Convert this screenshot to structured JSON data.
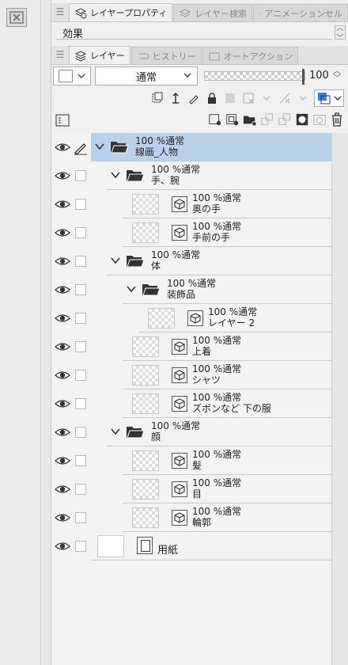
{
  "tabs_top": [
    {
      "label": "レイヤープロパティ",
      "active": true
    },
    {
      "label": "レイヤー検索",
      "active": false
    },
    {
      "label": "アニメーションセル",
      "active": false
    }
  ],
  "effect": {
    "label": "効果"
  },
  "tabs_layer": [
    {
      "label": "レイヤー",
      "active": true
    },
    {
      "label": "ヒストリー",
      "active": false
    },
    {
      "label": "オートアクション",
      "active": false
    }
  ],
  "blend": {
    "mode": "通常",
    "opacity": "100",
    "opacity_fraction": 1.0
  },
  "layers": [
    {
      "opacity": "100 %通常",
      "name": "線画_人物",
      "type": "folder",
      "depth": 0,
      "selected": true,
      "editing": true
    },
    {
      "opacity": "100 %通常",
      "name": "手、腕",
      "type": "folder",
      "depth": 1
    },
    {
      "opacity": "100 %通常",
      "name": "奥の手",
      "type": "layer",
      "depth": 2
    },
    {
      "opacity": "100 %通常",
      "name": "手前の手",
      "type": "layer",
      "depth": 2
    },
    {
      "opacity": "100 %通常",
      "name": "体",
      "type": "folder",
      "depth": 1
    },
    {
      "opacity": "100 %通常",
      "name": "装飾品",
      "type": "folder",
      "depth": 2
    },
    {
      "opacity": "100 %通常",
      "name": "レイヤー 2",
      "type": "layer",
      "depth": 3
    },
    {
      "opacity": "100 %通常",
      "name": "上着",
      "type": "layer",
      "depth": 2
    },
    {
      "opacity": "100 %通常",
      "name": "シャツ",
      "type": "layer",
      "depth": 2
    },
    {
      "opacity": "100 %通常",
      "name": "ズボンなど 下の服",
      "type": "layer",
      "depth": 2
    },
    {
      "opacity": "100 %通常",
      "name": "顔",
      "type": "folder",
      "depth": 1
    },
    {
      "opacity": "100 %通常",
      "name": "髪",
      "type": "layer",
      "depth": 2
    },
    {
      "opacity": "100 %通常",
      "name": "目",
      "type": "layer",
      "depth": 2
    },
    {
      "opacity": "100 %通常",
      "name": "輪郭",
      "type": "layer",
      "depth": 2
    }
  ],
  "paper": {
    "name": "用紙"
  },
  "colors": {
    "selection": "#b9d2ea",
    "accent": "#3b7fe0"
  },
  "icons": [
    "close-icon",
    "eye-icon",
    "pen-icon",
    "folder-open-icon",
    "chevron-down-icon",
    "cube-icon",
    "trash-icon",
    "lock-icon",
    "mask-icon"
  ]
}
